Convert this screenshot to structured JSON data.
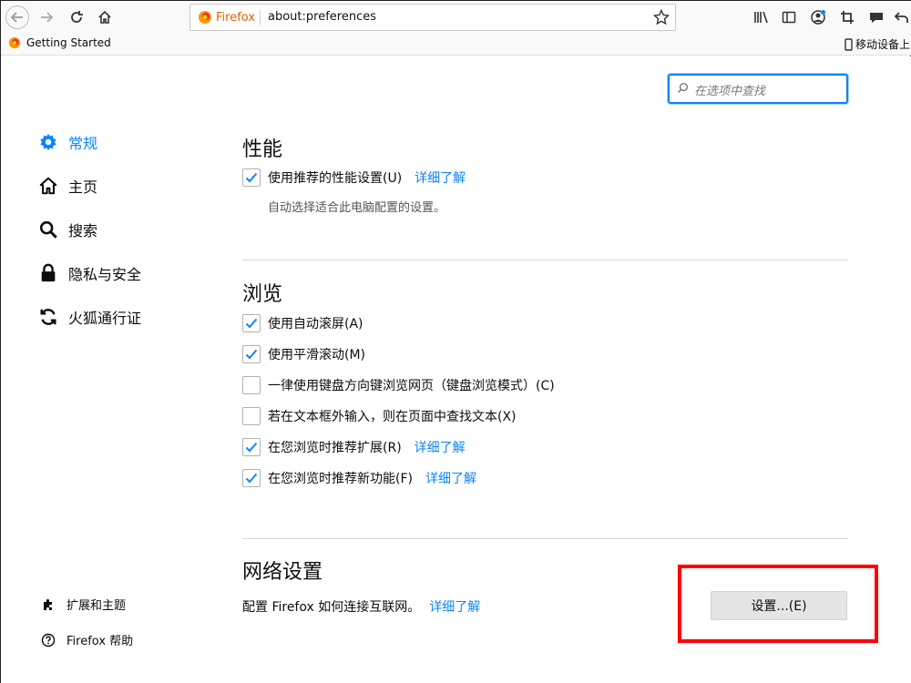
{
  "toolbar": {
    "identity_label": "Firefox",
    "url": "about:preferences"
  },
  "bookmarks": {
    "item_label": "Getting Started",
    "mobile_label": "移动设备上"
  },
  "search": {
    "placeholder": "在选项中查找"
  },
  "sidebar": {
    "items": [
      {
        "label": "常规"
      },
      {
        "label": "主页"
      },
      {
        "label": "搜索"
      },
      {
        "label": "隐私与安全"
      },
      {
        "label": "火狐通行证"
      }
    ],
    "footer": [
      {
        "label": "扩展和主题"
      },
      {
        "label": "Firefox 帮助"
      }
    ]
  },
  "performance": {
    "title": "性能",
    "recommended_label": "使用推荐的性能设置(U)",
    "recommended_checked": true,
    "learn_more": "详细了解",
    "description": "自动选择适合此电脑配置的设置。"
  },
  "browsing": {
    "title": "浏览",
    "options": [
      {
        "label": "使用自动滚屏(A)",
        "checked": true
      },
      {
        "label": "使用平滑滚动(M)",
        "checked": true
      },
      {
        "label": "一律使用键盘方向键浏览网页（键盘浏览模式）(C)",
        "checked": false
      },
      {
        "label": "若在文本框外输入，则在页面中查找文本(X)",
        "checked": false
      },
      {
        "label": "在您浏览时推荐扩展(R)",
        "checked": true,
        "link": "详细了解"
      },
      {
        "label": "在您浏览时推荐新功能(F)",
        "checked": true,
        "link": "详细了解"
      }
    ]
  },
  "network": {
    "title": "网络设置",
    "description": "配置 Firefox 如何连接互联网。",
    "learn_more": "详细了解",
    "button_label": "设置...(E)"
  },
  "colors": {
    "accent": "#0a84ff",
    "highlight": "#ff0000"
  }
}
